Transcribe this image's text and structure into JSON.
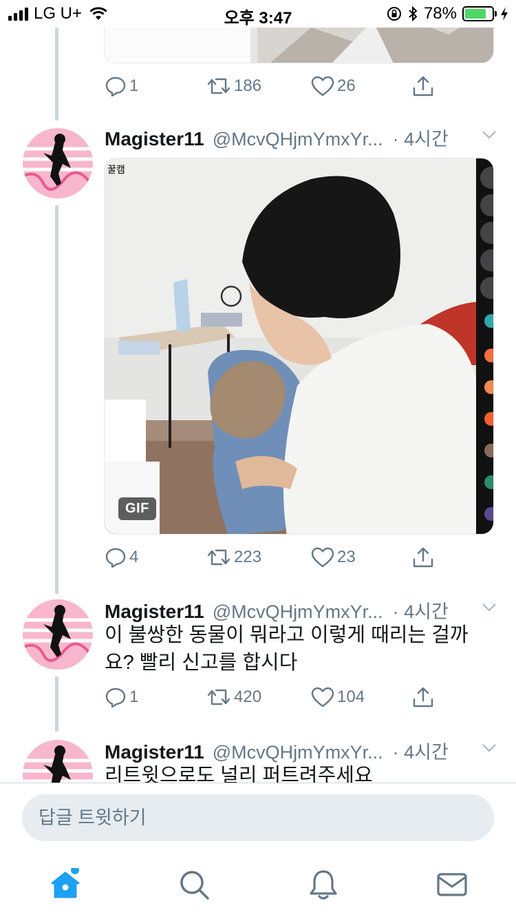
{
  "status_bar": {
    "carrier": "LG U+",
    "time": "오후 3:47",
    "battery_text": "78%",
    "battery_level": 0.78
  },
  "tweets": [
    {
      "actions": {
        "replies": "1",
        "retweets": "186",
        "likes": "26"
      }
    },
    {
      "name": "Magister11",
      "handle": "@McvQHjmYmxYr...",
      "time": "· 4시간",
      "media_badge": "GIF",
      "media_caption": "꿀캠",
      "actions": {
        "replies": "4",
        "retweets": "223",
        "likes": "23"
      }
    },
    {
      "name": "Magister11",
      "handle": "@McvQHjmYmxYr...",
      "time": "· 4시간",
      "text": "이 불쌍한 동물이 뭐라고 이렇게 때리는 걸까요? 빨리 신고를 합시다",
      "actions": {
        "replies": "1",
        "retweets": "420",
        "likes": "104"
      }
    },
    {
      "name": "Magister11",
      "handle": "@McvQHjmYmxYr...",
      "time": "· 4시간",
      "text": "리트윗으로도 널리 퍼트려주세요"
    }
  ],
  "reply": {
    "placeholder": "답글 트윗하기"
  },
  "colors": {
    "accent": "#1da1f2",
    "muted": "#657786",
    "divider": "#ccd6dd"
  }
}
